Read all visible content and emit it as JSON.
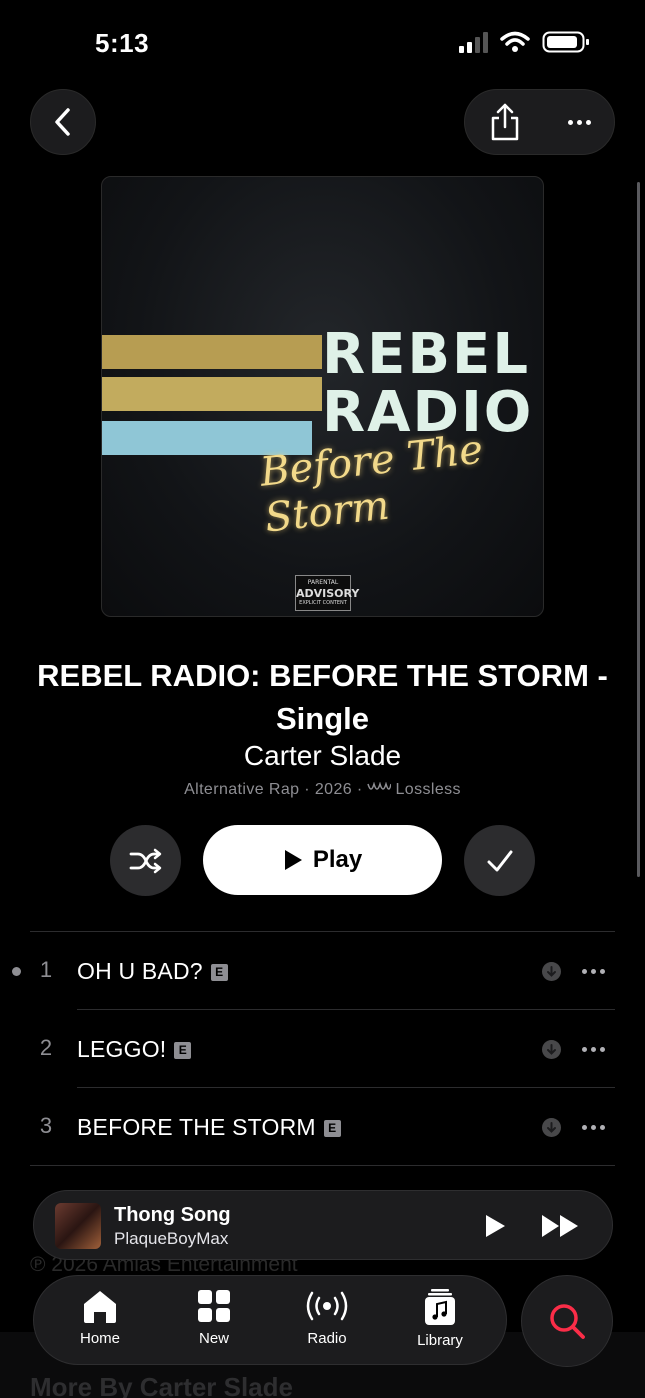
{
  "status_bar": {
    "time": "5:13"
  },
  "album": {
    "title": "REBEL RADIO: BEFORE THE STORM - Single",
    "artist": "Carter Slade",
    "meta_genre": "Alternative Rap · 2026 · ",
    "meta_quality": "Lossless",
    "artwork": {
      "title_line1": "REBEL",
      "title_line2": "RADIO",
      "script": "Before The Storm",
      "advisory_line1": "PARENTAL",
      "advisory_line2": "ADVISORY",
      "advisory_line3": "EXPLICIT CONTENT"
    }
  },
  "actions": {
    "play_label": "Play"
  },
  "tracks": [
    {
      "number": "1",
      "title": "OH U BAD?",
      "explicit": "E"
    },
    {
      "number": "2",
      "title": "LEGGO!",
      "explicit": "E"
    },
    {
      "number": "3",
      "title": "BEFORE THE STORM",
      "explicit": "E"
    }
  ],
  "footer": {
    "copyright": "℗ 2026 Amias Entertainment",
    "more_by": "More By Carter Slade"
  },
  "now_playing": {
    "title": "Thong Song",
    "artist": "PlaqueBoyMax"
  },
  "tabs": {
    "home": "Home",
    "new": "New",
    "radio": "Radio",
    "library": "Library"
  },
  "colors": {
    "accent": "#fa2d48",
    "background": "#000000",
    "surface": "#1c1c1e"
  }
}
